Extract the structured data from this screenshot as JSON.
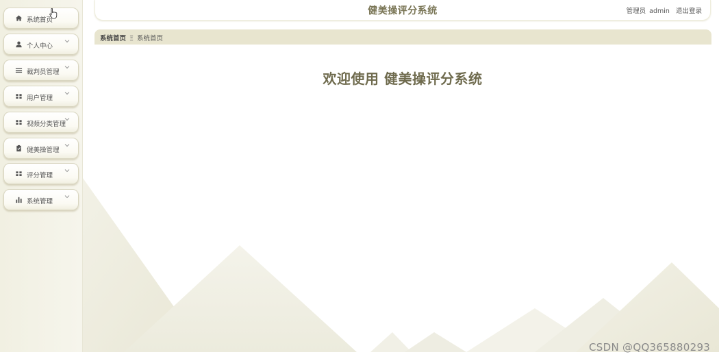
{
  "header": {
    "title": "健美操评分系统",
    "user_role": "管理员",
    "username": "admin",
    "logout_label": "退出登录"
  },
  "breadcrumb": {
    "home": "系统首页",
    "separator": "Ξ",
    "current": "系统首页"
  },
  "main": {
    "welcome": "欢迎使用 健美操评分系统"
  },
  "sidebar": {
    "items": [
      {
        "label": "系统首页",
        "icon": "home-icon"
      },
      {
        "label": "个人中心",
        "icon": "user-icon"
      },
      {
        "label": "裁判员管理",
        "icon": "list-icon"
      },
      {
        "label": "用户管理",
        "icon": "grid-icon"
      },
      {
        "label": "视频分类管理",
        "icon": "grid-icon"
      },
      {
        "label": "健美操管理",
        "icon": "clipboard-icon"
      },
      {
        "label": "评分管理",
        "icon": "grid-icon"
      },
      {
        "label": "系统管理",
        "icon": "bar-chart-icon"
      }
    ]
  },
  "watermark": "CSDN @QQ365880293",
  "colors": {
    "accent": "#7a7656",
    "sidebar_bg": "#f1f0e2",
    "breadcrumb_bg": "#e8e5cf"
  }
}
